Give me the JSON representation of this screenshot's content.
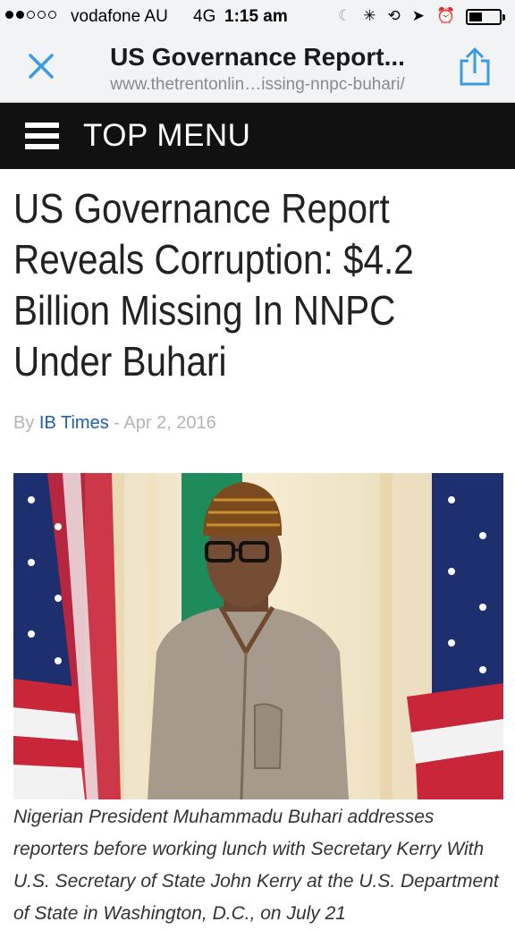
{
  "status_bar": {
    "carrier": "vodafone AU",
    "network": "4G",
    "time": "1:15 am",
    "signal_bars_filled": 2,
    "signal_bars_total": 5,
    "battery_fraction": 0.4,
    "icons": [
      "moon-icon",
      "loading-spinner-icon",
      "orientation-lock-icon",
      "location-arrow-icon",
      "alarm-icon",
      "battery-icon"
    ]
  },
  "browser": {
    "page_title": "US Governance Report...",
    "url": "www.thetrentonlin…issing-nnpc-buhari/",
    "close_icon": "close-icon",
    "share_icon": "share-icon",
    "accent_color": "#3b9be0"
  },
  "menu": {
    "label": "TOP MENU",
    "icon": "hamburger-icon",
    "background": "#111111"
  },
  "article": {
    "headline": "US Governance Report Reveals Corruption: $4.2 Billion Missing In NNPC Under Buhari",
    "byline_prefix": "By",
    "author": "IB Times",
    "separator": "-",
    "date": "Apr 2, 2016",
    "image_caption": "Nigerian President Muhammadu Buhari addresses reporters before working lunch with Secretary Kerry With U.S. Secretary of State John Kerry at the U.S. Department of State in Washington, D.C., on July 21"
  }
}
